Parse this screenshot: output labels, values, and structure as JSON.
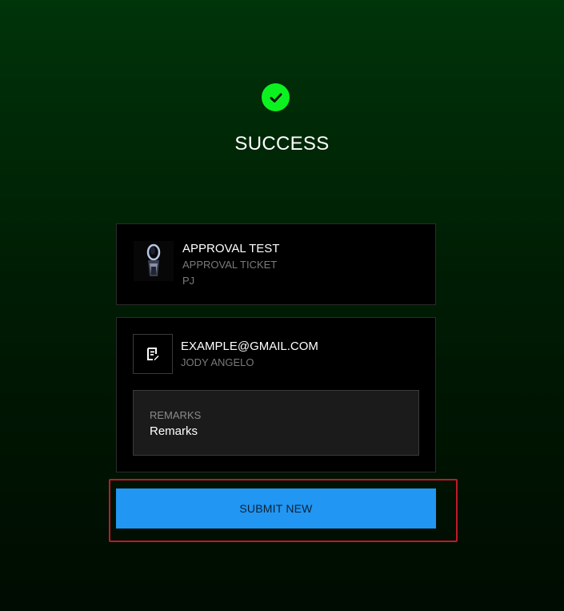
{
  "header": {
    "status_icon": "check-circle-icon",
    "status_color": "#0cf221",
    "title": "SUCCESS"
  },
  "ticket_card": {
    "thumbnail": "ticket-thumbnail-image",
    "title": "APPROVAL TEST",
    "subtitle": "APPROVAL TICKET",
    "code": "PJ"
  },
  "info_card": {
    "icon": "document-edit-icon",
    "email": "EXAMPLE@GMAIL.COM",
    "name": "JODY ANGELO",
    "remarks_label": "REMARKS",
    "remarks_value": "Remarks"
  },
  "actions": {
    "submit_label": "SUBMIT NEW",
    "submit_color": "#2196f3",
    "highlight_color": "#c0182a"
  }
}
